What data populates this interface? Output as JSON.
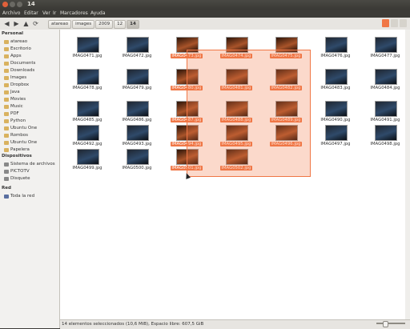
{
  "window": {
    "title": "14"
  },
  "menubar": {
    "items": [
      "Archivo",
      "Editar",
      "Ver",
      "Ir",
      "Marcadores",
      "Ayuda"
    ]
  },
  "toolbar": {
    "back_icon": "back-arrow-icon",
    "forward_icon": "forward-arrow-icon",
    "up_icon": "up-arrow-icon",
    "reload_icon": "reload-icon",
    "breadcrumbs": [
      "atareao",
      "images",
      "2009",
      "12",
      "14"
    ]
  },
  "sidebar": {
    "personal_header": "Personal",
    "personal": [
      "atareao",
      "Escritorio",
      "Apps",
      "Documents",
      "Downloads",
      "Images",
      "Dropbox",
      "Java",
      "Movies",
      "Music",
      "PDF",
      "Python",
      "Ubuntu One",
      "Rombos",
      "Ubuntu One",
      "Papelera"
    ],
    "devices_header": "Dispositivos",
    "devices": [
      "Sistema de archivos",
      "PICTOTV",
      "Disquete"
    ],
    "network_header": "Red",
    "network": [
      "Toda la red"
    ]
  },
  "files": [
    {
      "name": "IMAG0471.jpg",
      "selected": false
    },
    {
      "name": "IMAG0472.jpg",
      "selected": false
    },
    {
      "name": "IMAG0473.jpg",
      "selected": true
    },
    {
      "name": "IMAG0474.jpg",
      "selected": true
    },
    {
      "name": "IMAG0475.jpg",
      "selected": true
    },
    {
      "name": "IMAG0476.jpg",
      "selected": false
    },
    {
      "name": "IMAG0477.jpg",
      "selected": false
    },
    {
      "name": "IMAG0478.jpg",
      "selected": false
    },
    {
      "name": "IMAG0479.jpg",
      "selected": false
    },
    {
      "name": "IMAG0480.jpg",
      "selected": true
    },
    {
      "name": "IMAG0481.jpg",
      "selected": true
    },
    {
      "name": "IMAG0482.jpg",
      "selected": true
    },
    {
      "name": "IMAG0483.jpg",
      "selected": false
    },
    {
      "name": "IMAG0484.jpg",
      "selected": false
    },
    {
      "name": "IMAG0485.jpg",
      "selected": false
    },
    {
      "name": "IMAG0486.jpg",
      "selected": false
    },
    {
      "name": "IMAG0487.jpg",
      "selected": true
    },
    {
      "name": "IMAG0488.jpg",
      "selected": true
    },
    {
      "name": "IMAG0489.jpg",
      "selected": true
    },
    {
      "name": "IMAG0490.jpg",
      "selected": false
    },
    {
      "name": "IMAG0491.jpg",
      "selected": false
    },
    {
      "name": "IMAG0492.jpg",
      "selected": false
    },
    {
      "name": "IMAG0493.jpg",
      "selected": false
    },
    {
      "name": "IMAG0494.jpg",
      "selected": true
    },
    {
      "name": "IMAG0495.jpg",
      "selected": true
    },
    {
      "name": "IMAG0496.jpg",
      "selected": true
    },
    {
      "name": "IMAG0497.jpg",
      "selected": false
    },
    {
      "name": "IMAG0498.jpg",
      "selected": false
    },
    {
      "name": "IMAG0499.jpg",
      "selected": false
    },
    {
      "name": "IMAG0500.jpg",
      "selected": false
    },
    {
      "name": "IMAG0501.jpg",
      "selected": true
    },
    {
      "name": "IMAG0502.jpg",
      "selected": true
    }
  ],
  "statusbar": {
    "text": "14 elementos seleccionados (10,6 MiB), Espacio libre: 607,5 GiB"
  },
  "colors": {
    "selection": "#f07746",
    "close_button": "#e0603a"
  }
}
